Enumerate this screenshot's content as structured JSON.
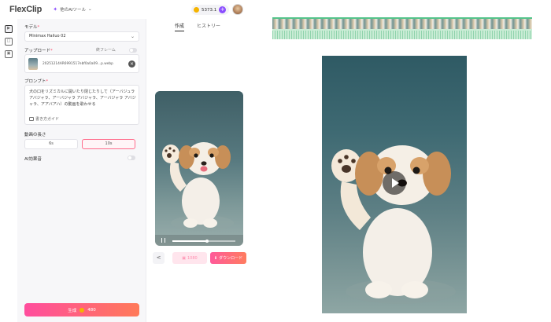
{
  "app": {
    "logo": "FlexClip"
  },
  "header": {
    "tools_menu_label": "他のAIツール",
    "credits": "5373.1"
  },
  "settings": {
    "model_label": "モデル",
    "model_value": "Minimax Hailuo 02",
    "upload_label": "アップロード",
    "last_frame_label": "終フレーム",
    "file_name": "20251214AR6991517ebf0a0a09...p.webp",
    "prompt_label": "プロンプト",
    "prompt_text": "犬の口をリズミカルに開いたり閉じたりして（アーバジュラ アバジャラ、アーバジャラ アバジャラ、アーバジャラ アバジャラ、アアバアハ）の動画を歌わせる",
    "guide_label": "書き方ガイド",
    "duration_label": "動画の長さ",
    "duration_options": [
      "6s",
      "10s"
    ],
    "duration_selected": "10s",
    "ai_sound_label": "AI効果音",
    "generate_label": "生成",
    "generate_cost": "480"
  },
  "preview": {
    "tabs": [
      "作成",
      "ヒストリー"
    ],
    "active_tab": "作成",
    "hd_label": "1080",
    "download_label": "ダウンロード",
    "progress": 0.55
  },
  "colors": {
    "accent_pink": "#ff4d9d",
    "accent_orange": "#ff7a59",
    "brand_purple": "#8a4dff",
    "timeline_green": "#54c38a"
  }
}
